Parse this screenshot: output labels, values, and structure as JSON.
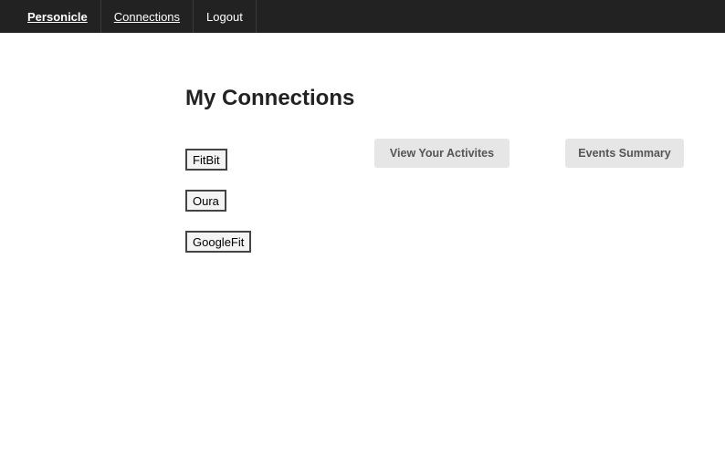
{
  "navbar": {
    "brand": "Personicle",
    "items": [
      {
        "label": "Connections"
      },
      {
        "label": "Logout"
      }
    ]
  },
  "main": {
    "title": "My Connections",
    "connections": [
      {
        "label": "FitBit"
      },
      {
        "label": "Oura"
      },
      {
        "label": "GoogleFit"
      }
    ],
    "actions": {
      "view_activities": "View Your Activites",
      "events_summary": "Events Summary"
    }
  }
}
